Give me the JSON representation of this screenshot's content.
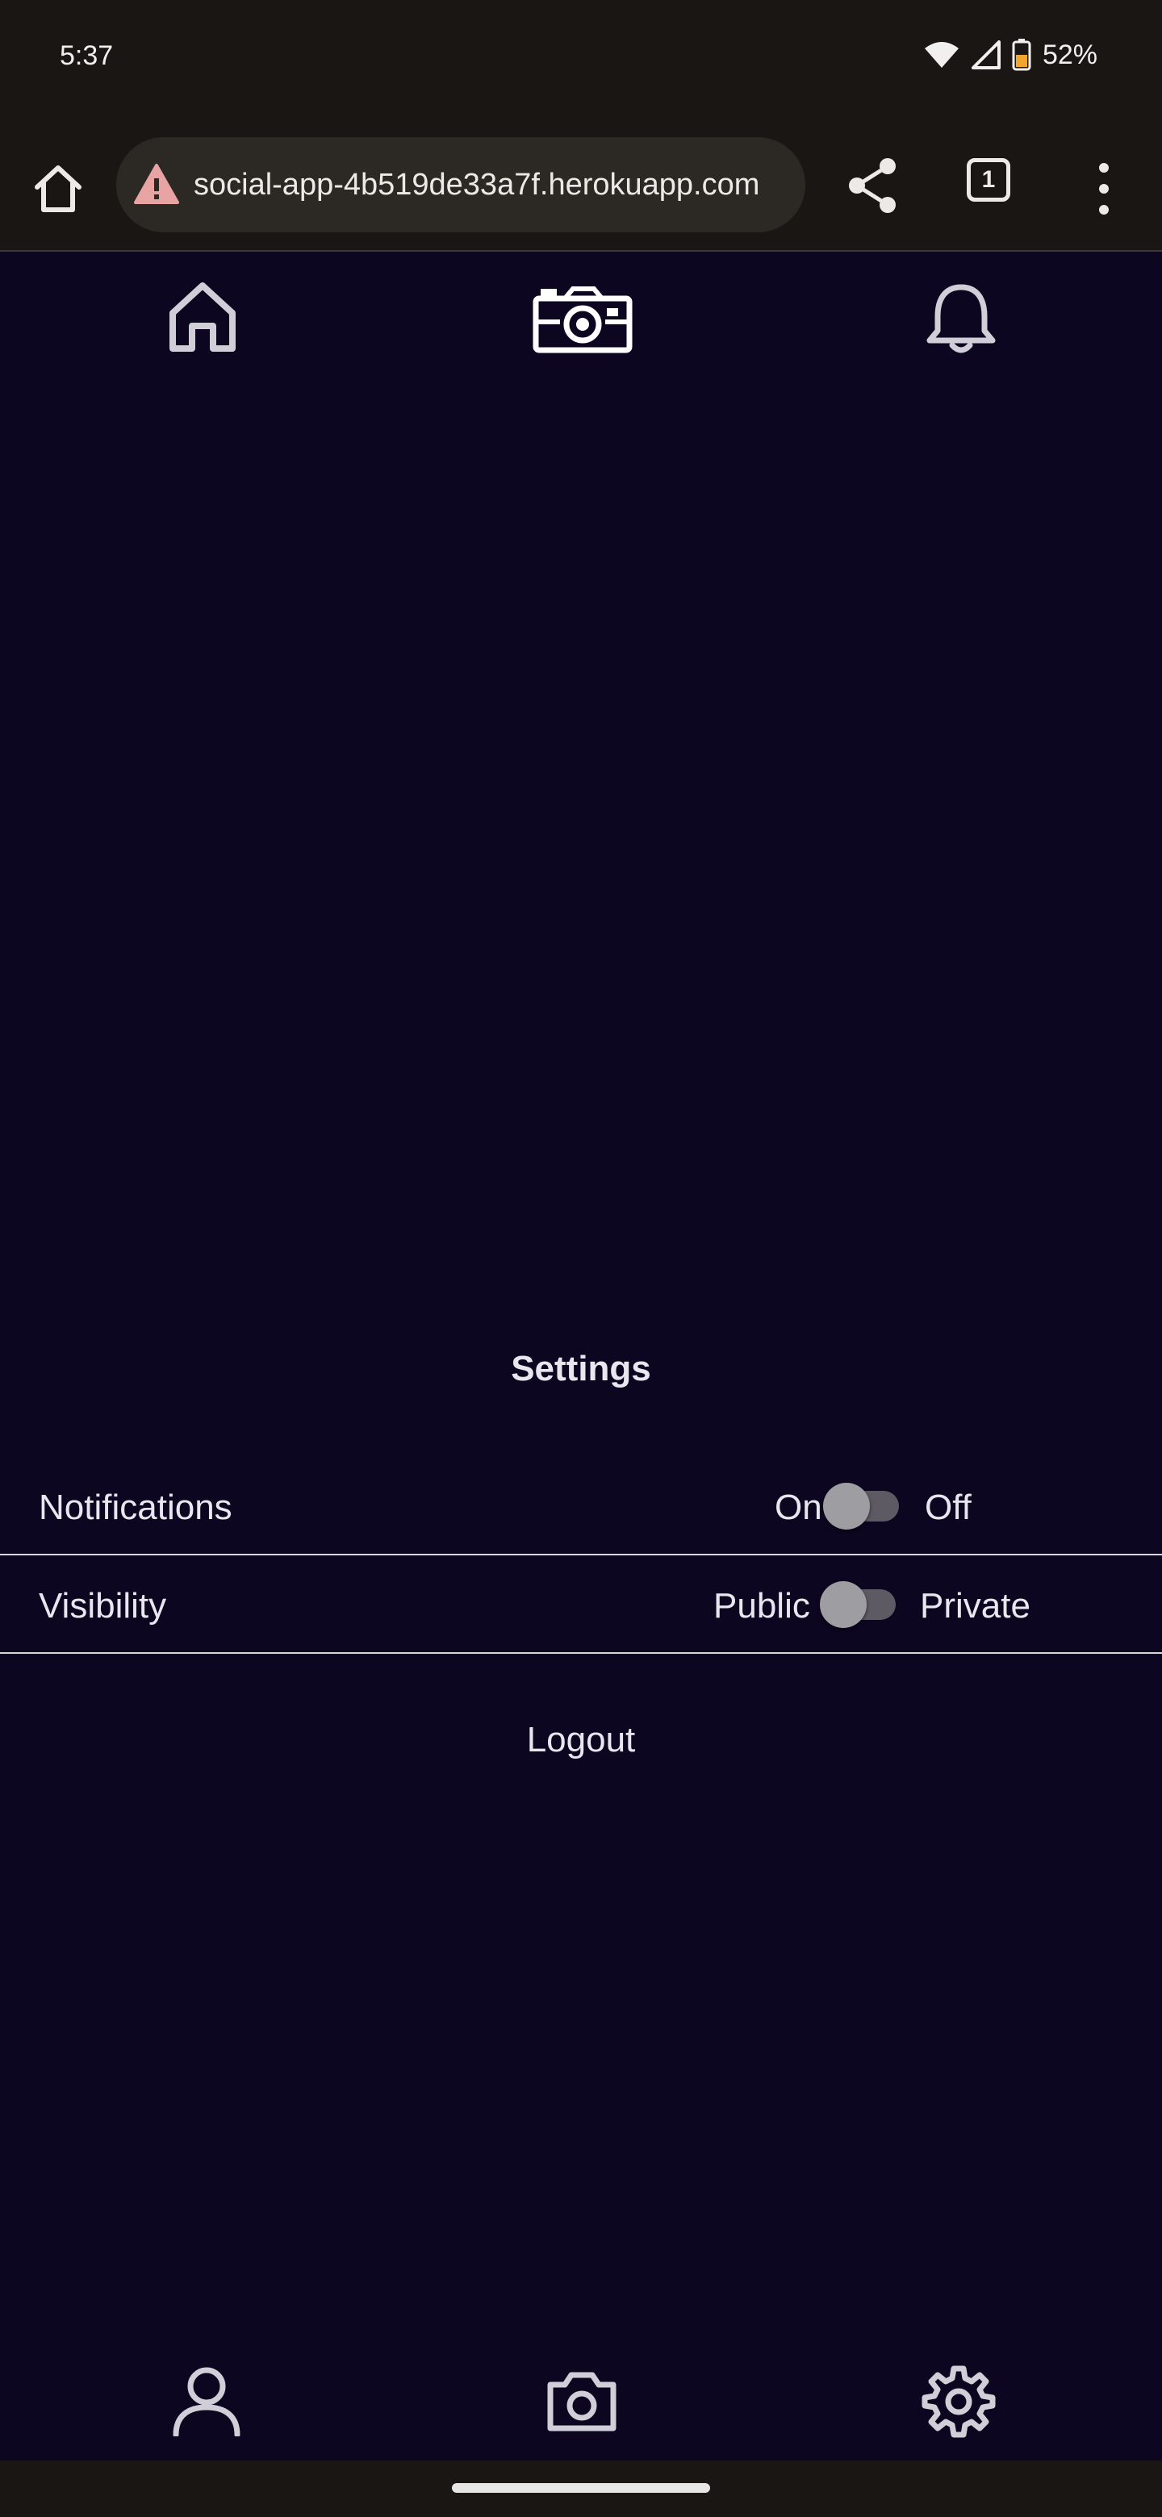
{
  "status_bar": {
    "time": "5:37",
    "battery": "52%",
    "icons": [
      "wifi-icon",
      "signal-icon",
      "battery-icon"
    ]
  },
  "browser": {
    "url": "social-app-4b519de33a7f.herokuapp.com",
    "tab_count": "1",
    "icons": [
      "home-icon",
      "warning-icon",
      "share-icon",
      "tabs-icon",
      "menu-icon"
    ]
  },
  "top_nav": {
    "icons": [
      "home-icon",
      "camera-retro-icon",
      "bell-icon"
    ]
  },
  "settings": {
    "title": "Settings",
    "rows": [
      {
        "label": "Notifications",
        "option_left": "On",
        "option_right": "Off"
      },
      {
        "label": "Visibility",
        "option_left": "Public",
        "option_right": "Private"
      }
    ],
    "logout_label": "Logout"
  },
  "bottom_nav": {
    "icons": [
      "user-icon",
      "camera-icon",
      "gear-icon"
    ]
  },
  "colors": {
    "background": "#0d0620",
    "chrome": "#1a1613",
    "url_pill": "#2c2925",
    "text": "#e8e6ee",
    "switch_track": "#5d5a63",
    "switch_knob": "#9e9da2",
    "warning": "#e8a3a3"
  }
}
